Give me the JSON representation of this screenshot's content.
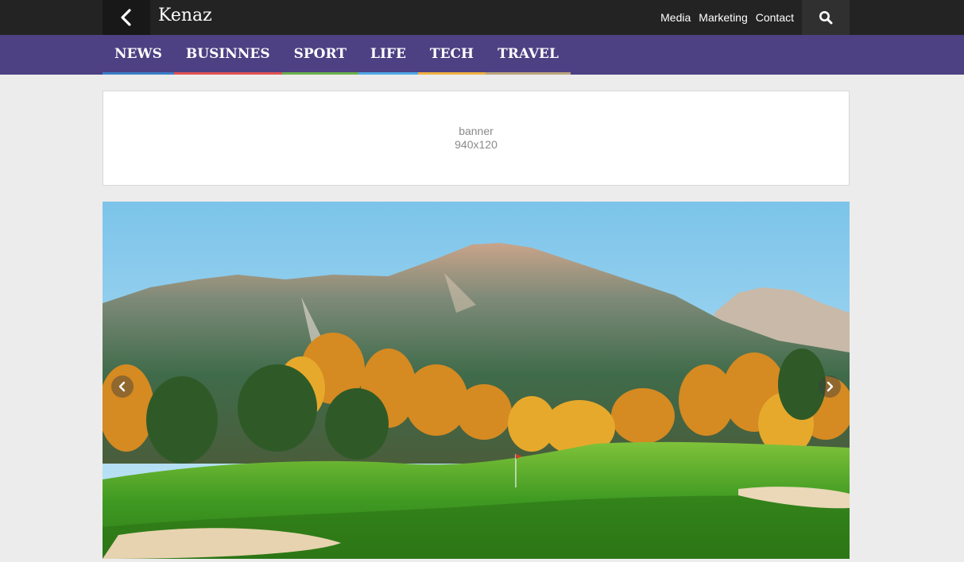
{
  "header": {
    "brand": "Kenaz",
    "links": [
      "Media",
      "Marketing",
      "Contact"
    ],
    "back_icon": "chevron-left-icon",
    "search_icon": "search-icon"
  },
  "nav": {
    "categories": [
      {
        "label": "NEWS",
        "color": "#3b7ec8"
      },
      {
        "label": "BUSINNES",
        "color": "#e05252"
      },
      {
        "label": "SPORT",
        "color": "#6ab04c"
      },
      {
        "label": "LIFE",
        "color": "#4fa8e8"
      },
      {
        "label": "TECH",
        "color": "#f0b040"
      },
      {
        "label": "TRAVEL",
        "color": "#b9a47a"
      }
    ]
  },
  "banner": {
    "line1": "banner",
    "line2": "940x120"
  },
  "hero": {
    "prev_icon": "chevron-left-icon",
    "next_icon": "chevron-right-icon",
    "image": "mountain-golf-course-landscape"
  },
  "colors": {
    "topbar": "#232323",
    "nav": "#4d4183",
    "page_bg": "#ececec"
  }
}
